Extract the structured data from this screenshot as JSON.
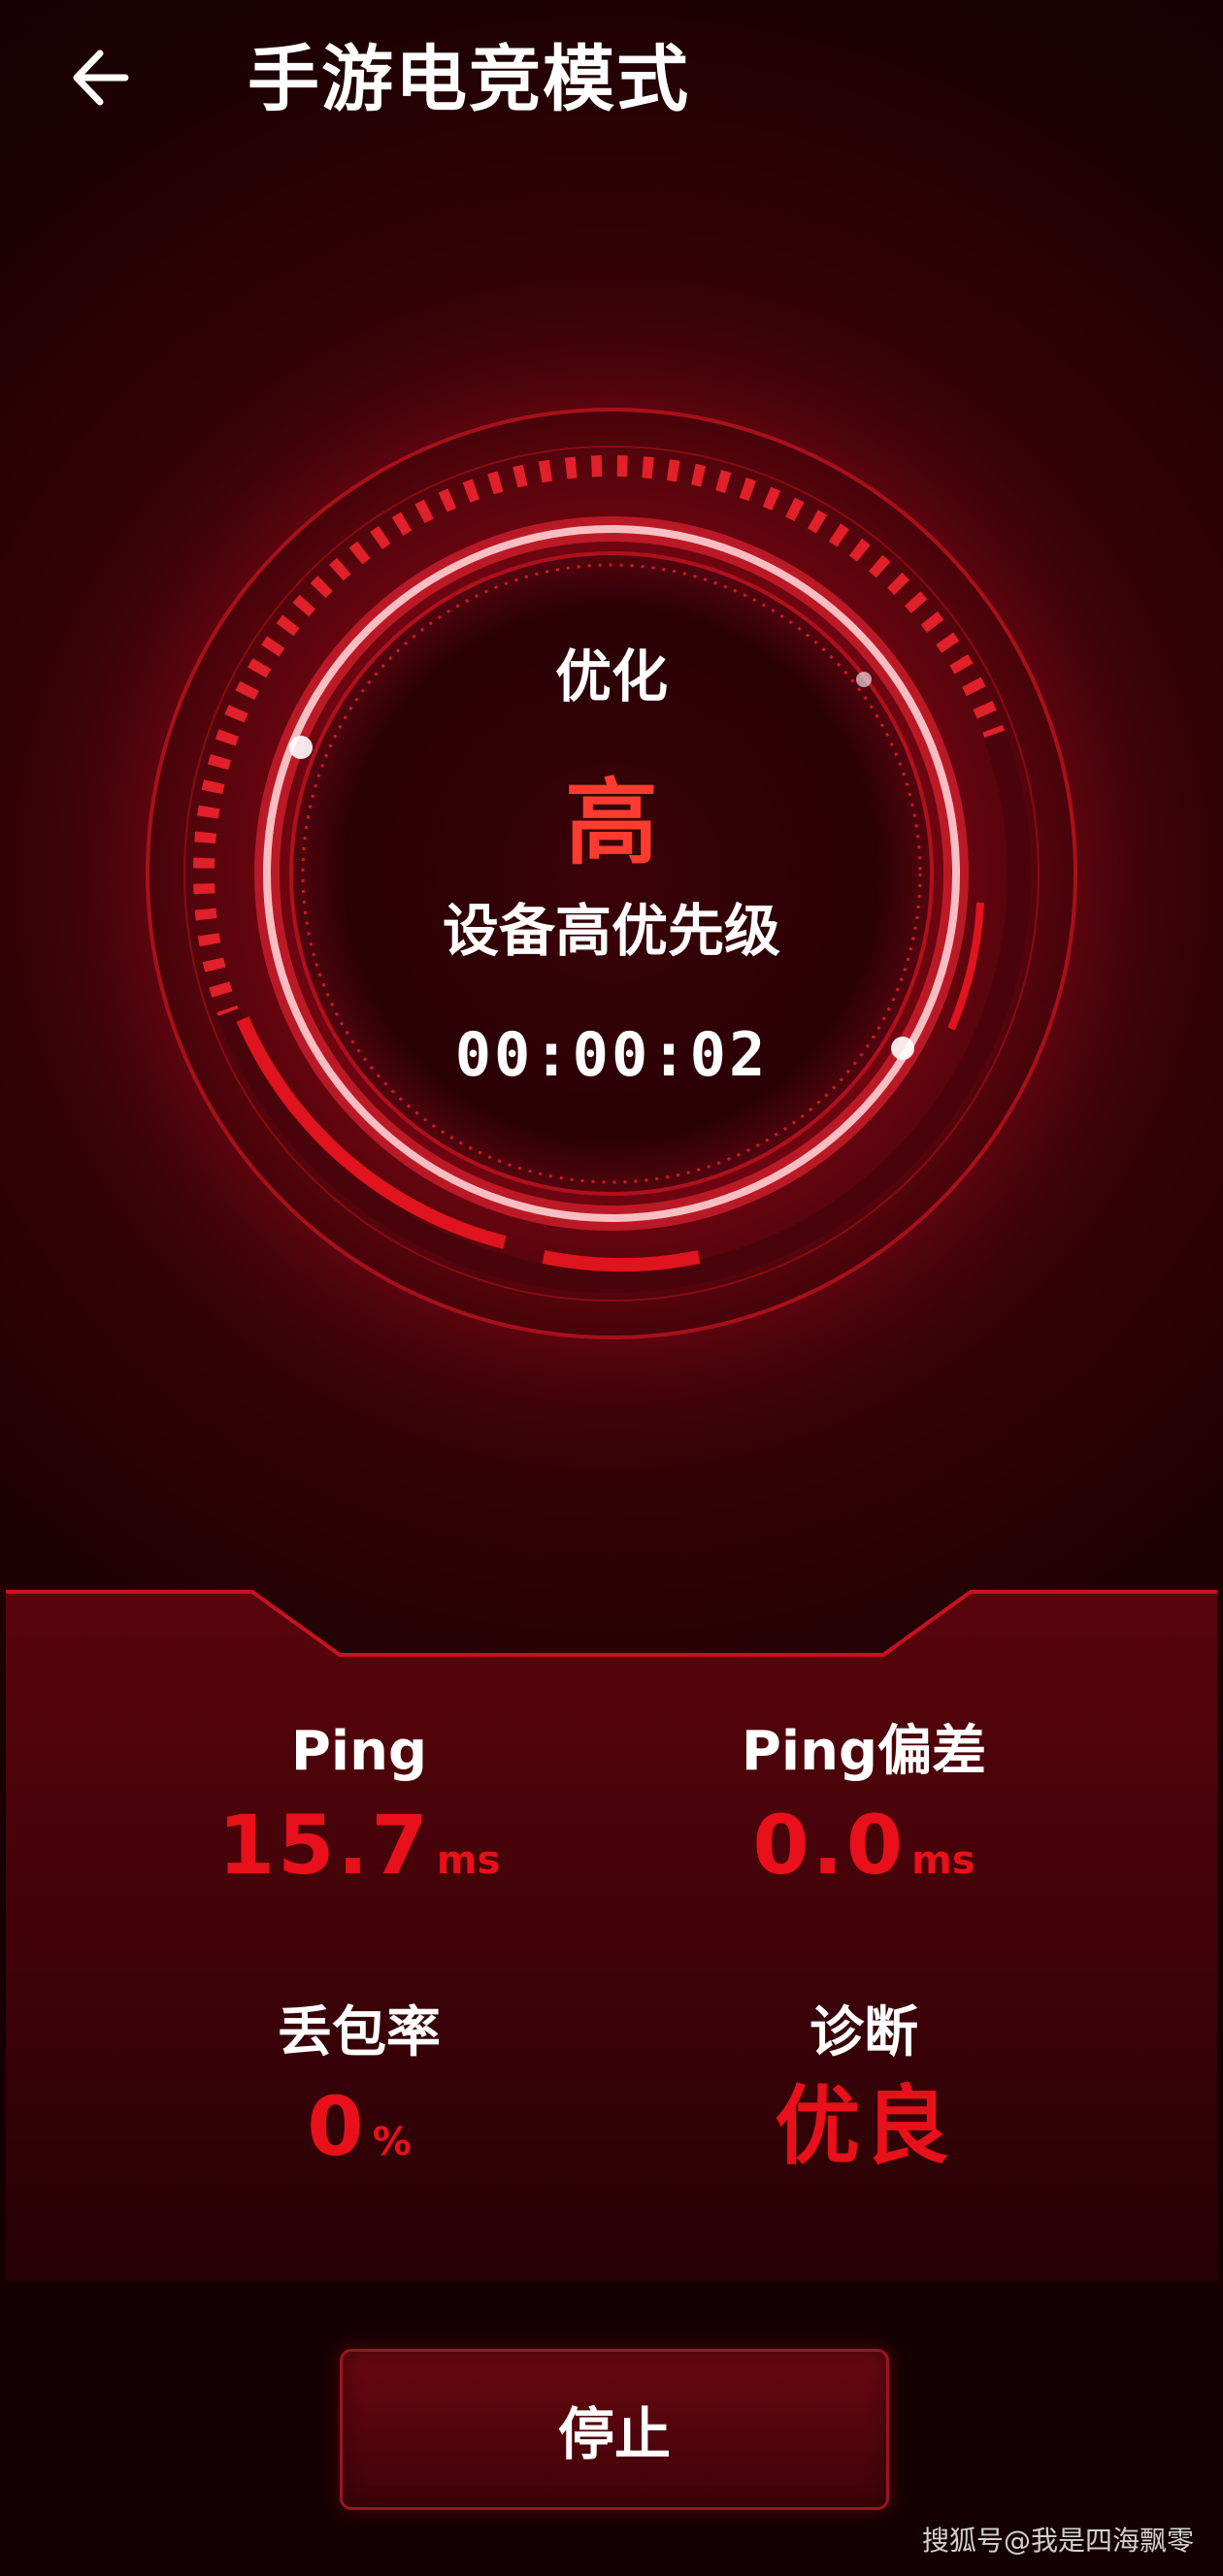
{
  "header": {
    "title": "手游电竞模式"
  },
  "dial": {
    "label": "优化",
    "level": "高",
    "subtitle": "设备高优先级",
    "timer": "00:00:02"
  },
  "stats": {
    "ping": {
      "label": "Ping",
      "value": "15.7",
      "unit": "ms"
    },
    "ping_deviation": {
      "label": "Ping偏差",
      "value": "0.0",
      "unit": "ms"
    },
    "packet_loss": {
      "label": "丢包率",
      "value": "0",
      "unit": "%"
    },
    "diagnosis": {
      "label": "诊断",
      "value": "优良"
    }
  },
  "actions": {
    "stop_label": "停止"
  },
  "watermark": "搜狐号@我是四海飘零",
  "colors": {
    "accent_red": "#e8101a",
    "level_red": "#ff3b2f",
    "background": "#1a0003"
  }
}
